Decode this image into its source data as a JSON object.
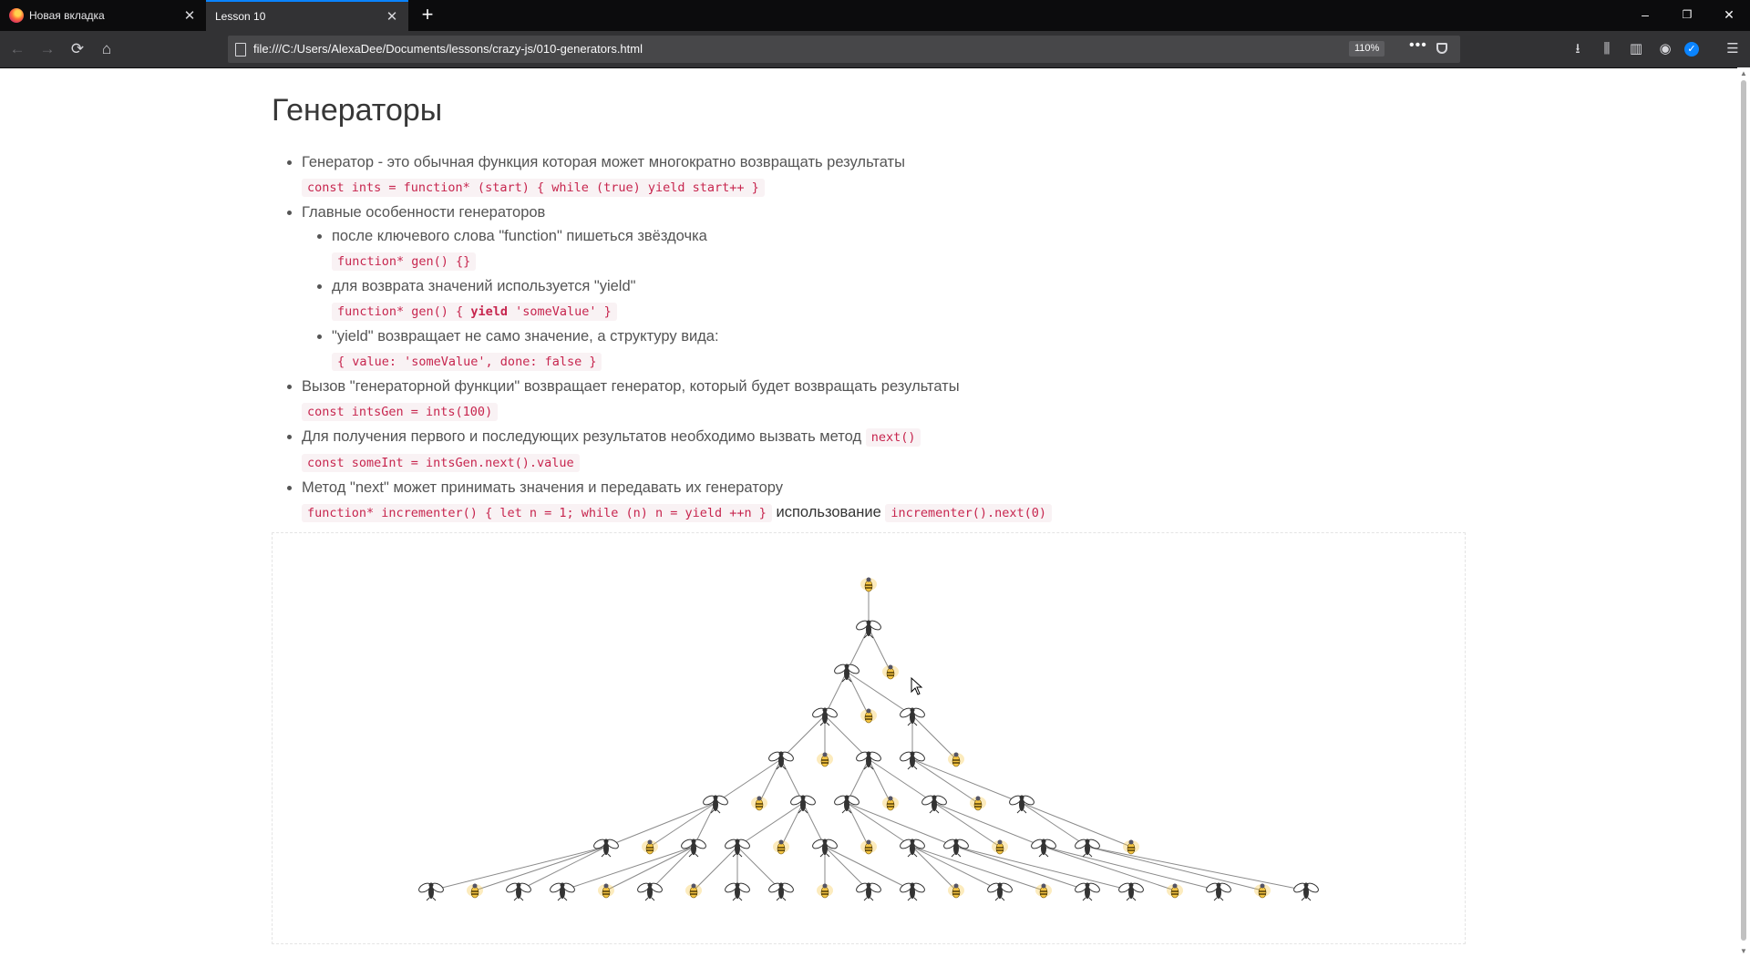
{
  "tabs": [
    {
      "label": "Новая вкладка",
      "active": false
    },
    {
      "label": "Lesson 10",
      "active": true
    }
  ],
  "window_controls": {
    "minimize": "–",
    "restore": "❐",
    "close": "✕"
  },
  "url": "file:///C:/Users/AlexaDee/Documents/lessons/crazy-js/010-generators.html",
  "zoom": "110%",
  "page": {
    "title": "Генераторы",
    "items": [
      {
        "text": "Генератор - это обычная функция которая может многократно возвращать результаты",
        "code": "const ints = function* (start) { while (true) yield start++ }"
      },
      {
        "text": "Главные особенности генераторов",
        "sub": [
          {
            "text": "после ключевого слова \"function\" пишеться звёздочка",
            "code": "function* gen() {}"
          },
          {
            "text": "для возврата значений используется \"yield\"",
            "code_pre": "function* gen() { ",
            "code_bold": "yield",
            "code_post": " 'someValue' }"
          },
          {
            "text": "\"yield\" возвращает не само значение, а структуру вида:",
            "code": "{ value: 'someValue', done: false }"
          }
        ]
      },
      {
        "text": "Вызов \"генераторной функции\" возвращает генератор, который будет возвращать результаты",
        "code": "const intsGen = ints(100)"
      },
      {
        "text": "Для получения первого и последующих результатов необходимо вызвать метод",
        "inline_code": "next()",
        "code": "const someInt = intsGen.next().value"
      },
      {
        "text": "Метод \"next\" может принимать значения и передавать их генератору",
        "code": "function* incrementer() { let n = 1; while (n) n = yield ++n }",
        "usage_label": "использование",
        "usage_code": "incrementer().next(0)"
      }
    ]
  },
  "tree": {
    "levels": [
      [
        "bee"
      ],
      [
        "fly"
      ],
      [
        "fly",
        "bee"
      ],
      [
        "fly",
        "bee",
        "fly"
      ],
      [
        "fly",
        "bee",
        "fly",
        "fly",
        "bee"
      ],
      [
        "fly",
        "bee",
        "fly",
        "fly",
        "bee",
        "fly",
        "bee",
        "fly"
      ],
      [
        "fly",
        "bee",
        "fly",
        "fly",
        "bee",
        "fly",
        "bee",
        "fly",
        "fly",
        "bee",
        "fly",
        "fly",
        "bee"
      ],
      [
        "fly",
        "bee",
        "fly",
        "fly",
        "bee",
        "fly",
        "bee",
        "fly",
        "fly",
        "bee",
        "fly",
        "fly",
        "bee",
        "fly",
        "bee",
        "fly",
        "fly",
        "bee",
        "fly",
        "bee",
        "fly"
      ]
    ]
  },
  "colors": {
    "code": "#c7254e",
    "code_bg": "#f9f2f4",
    "text": "#545454",
    "bee_yellow": "#f5c542",
    "accent_tab": "#0a84ff"
  }
}
